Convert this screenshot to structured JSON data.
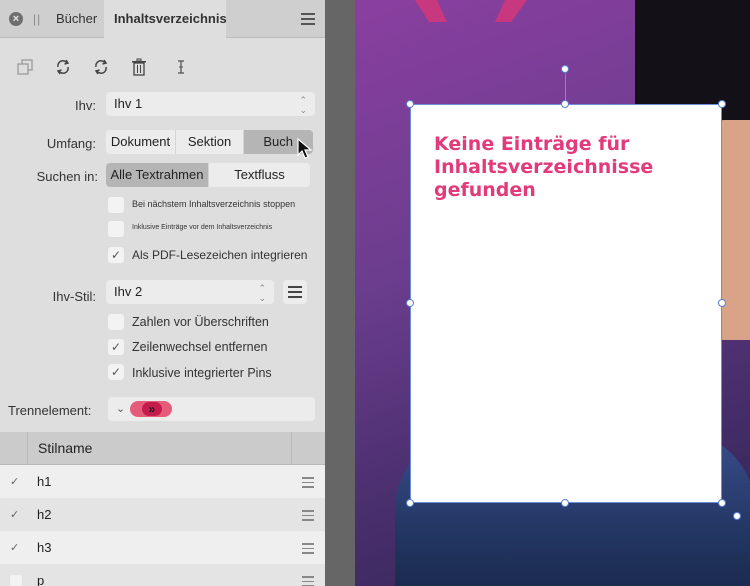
{
  "tabs": {
    "books": "Bücher",
    "toc": "Inhaltsverzeichnis"
  },
  "toolbar_icons": [
    "duplicate-icon",
    "refresh-icon",
    "update-icon",
    "delete-icon",
    "text-cursor-icon"
  ],
  "toc": {
    "label": "Ihv:",
    "value": "Ihv 1"
  },
  "scope": {
    "label": "Umfang:",
    "options": [
      "Dokument",
      "Sektion",
      "Buch"
    ],
    "selected": "Buch"
  },
  "search_in": {
    "label": "Suchen in:",
    "options": [
      "Alle Textrahmen",
      "Textfluss"
    ],
    "selected": "Alle Textrahmen"
  },
  "options_top": [
    {
      "label": "Bei nächstem Inhaltsverzeichnis stoppen",
      "checked": false
    },
    {
      "label": "Inklusive Einträge vor dem Inhaltsverzeichnis",
      "checked": false
    },
    {
      "label": "Als PDF-Lesezeichen integrieren",
      "checked": true
    }
  ],
  "style": {
    "label": "Ihv-Stil:",
    "value": "Ihv 2"
  },
  "options_style": [
    {
      "label": "Zahlen vor Überschriften",
      "checked": false
    },
    {
      "label": "Zeilenwechsel entfernen",
      "checked": true
    },
    {
      "label": "Inklusive integrierter Pins",
      "checked": true
    }
  ],
  "separator": {
    "label": "Trennelement:",
    "glyph": "»"
  },
  "table": {
    "header": "Stilname",
    "rows": [
      {
        "name": "h1",
        "checked": true
      },
      {
        "name": "h2",
        "checked": true
      },
      {
        "name": "h3",
        "checked": true
      },
      {
        "name": "p",
        "checked": false
      }
    ]
  },
  "canvas": {
    "frame_text": "Keine Einträge für Inhaltsverzeichnisse gefunden"
  },
  "colors": {
    "accent": "#e23a7a",
    "selection": "#5a7fd0",
    "panel": "#dedede"
  }
}
